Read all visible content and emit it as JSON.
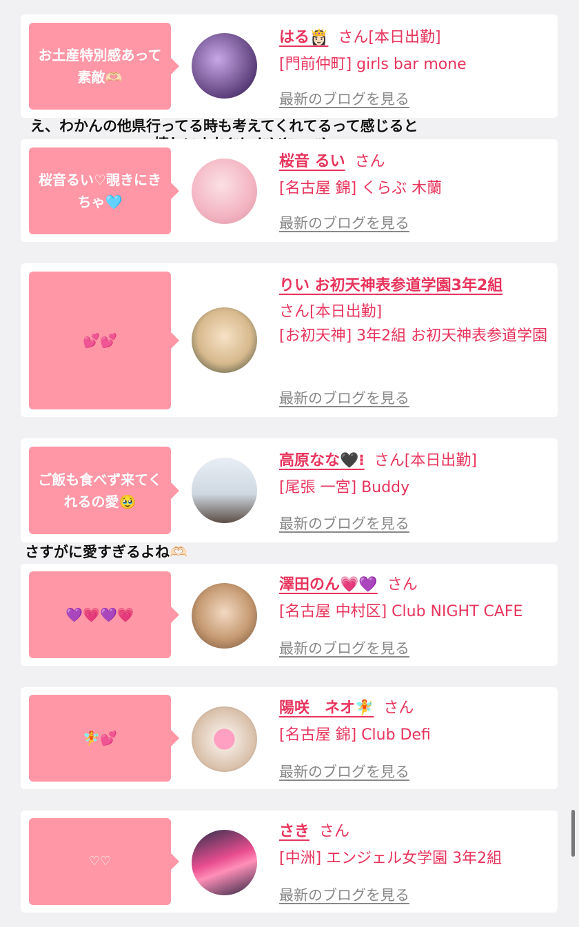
{
  "blog_link_label": "最新のブログを見る",
  "san": "さん",
  "cards": [
    {
      "bubble": "お土産特別感あって素敵🫶🏻",
      "name": "はる👸🏻",
      "status": "[本日出勤]",
      "shop": "[門前仲町] girls bar mone"
    },
    {
      "bubble": "桜音るい♡覗きにきちゃ🩵",
      "name": "桜音 るい",
      "status": "",
      "shop": "[名古屋 錦] くらぶ 木蘭"
    },
    {
      "bubble": "💕💕",
      "name": "りい お初天神表参道学園3年2組",
      "status": "[本日出勤]",
      "shop": "[お初天神] 3年2組 お初天神表参道学園"
    },
    {
      "bubble": "ご飯も食べず来てくれるの愛🥹",
      "name": "高原なな🖤⁝",
      "status": "[本日出勤]",
      "shop": "[尾張 一宮] Buddy"
    },
    {
      "bubble": "💜💗💜💗",
      "name": "澤田のん💗💜",
      "status": "",
      "shop": "[名古屋 中村区] Club NIGHT CAFE"
    },
    {
      "bubble": "🧚💕",
      "name": "陽咲　ネオ🧚",
      "status": "",
      "shop": "[名古屋 錦] Club Defi"
    },
    {
      "bubble": "♡♡",
      "name": "さき",
      "status": "",
      "shop": "[中洲] エンジェル女学園 3年2組"
    }
  ],
  "overlays": {
    "note1_line1": "え、わかんの他県行ってる時も考えてくれてるって感じると",
    "note1_line2": "嬉しいよね(ᐡ˙ ̫ ˙ᐡ)/(ᐡ- ̫ -ᐡ)",
    "note2": "さすがに愛すぎるよね🫶🏻"
  }
}
